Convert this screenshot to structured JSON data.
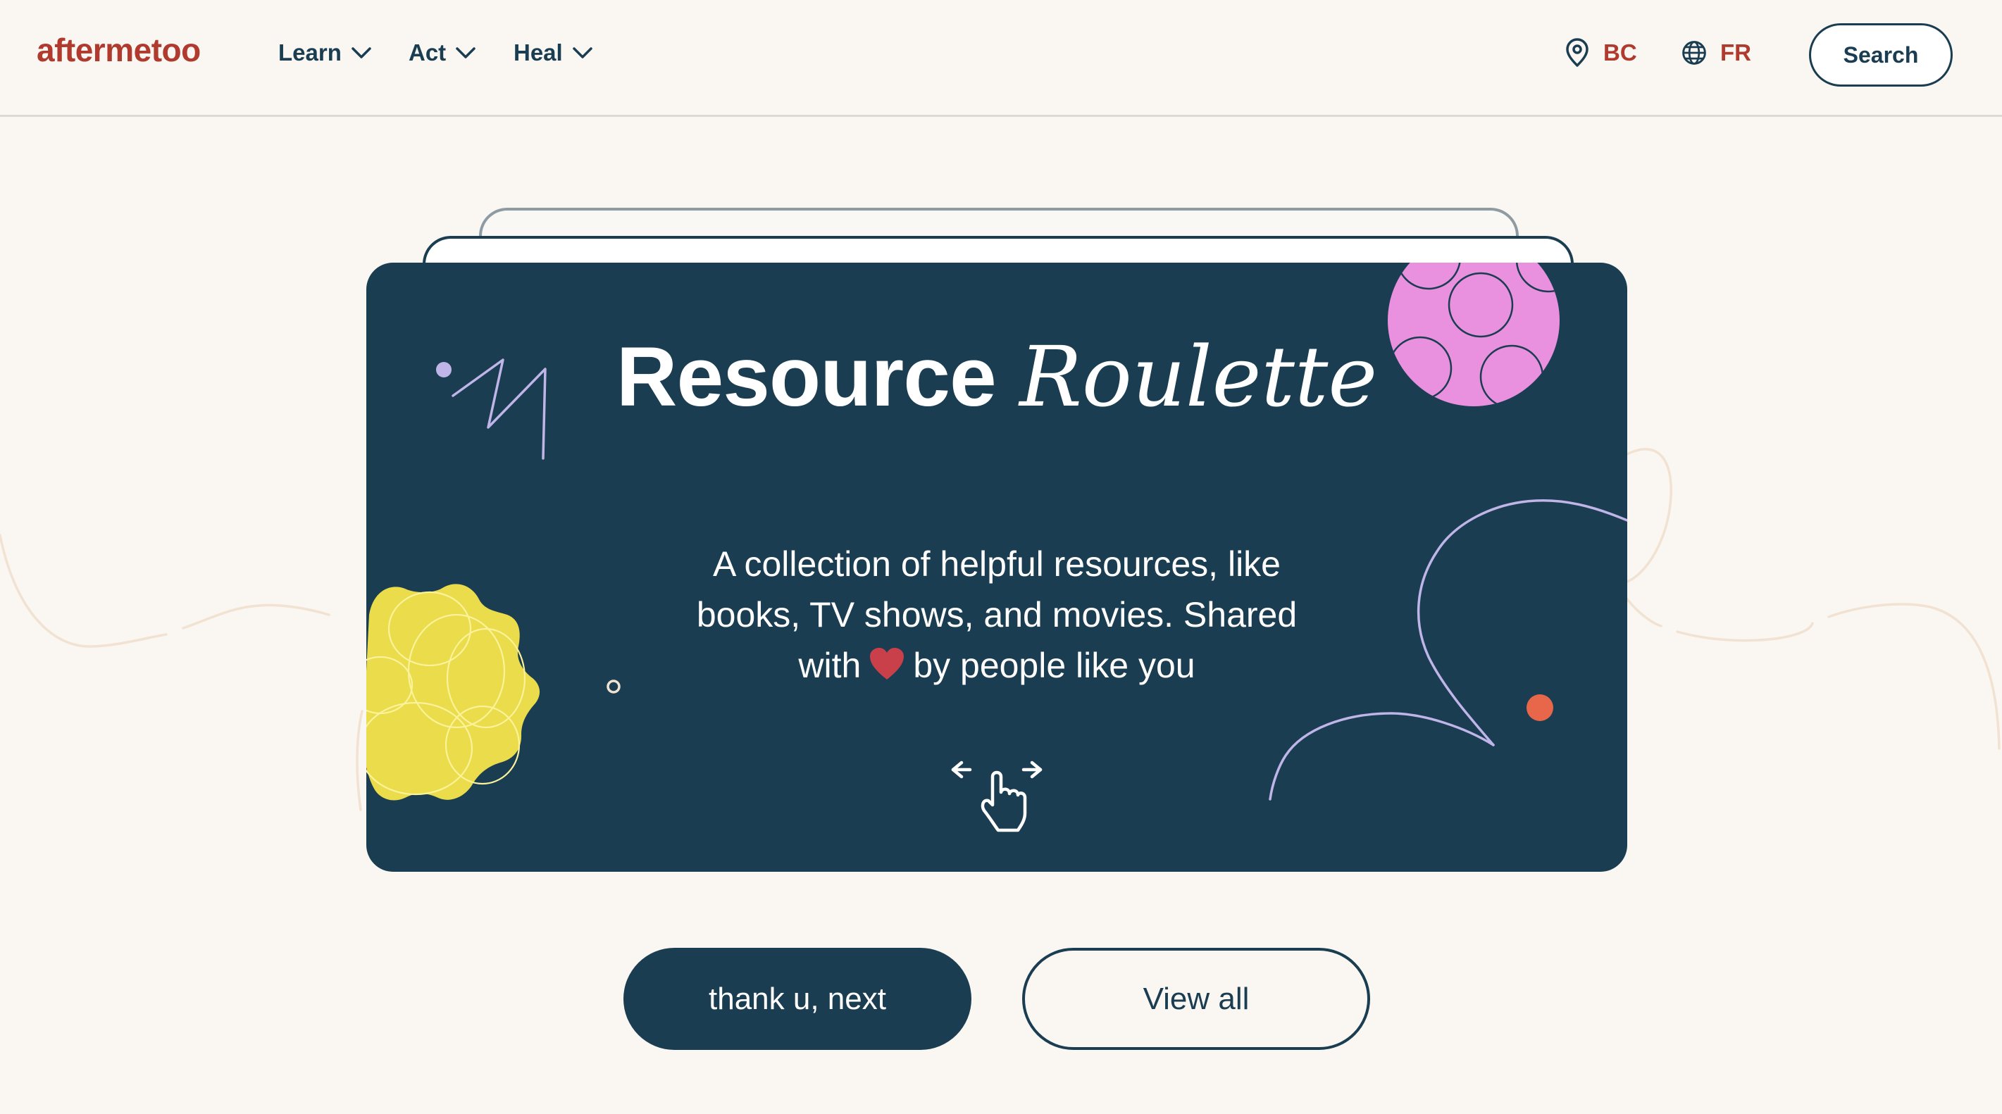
{
  "header": {
    "logo": "aftermetoo",
    "nav": [
      {
        "label": "Learn",
        "icon": "chevron-down-icon"
      },
      {
        "label": "Act",
        "icon": "chevron-down-icon"
      },
      {
        "label": "Heal",
        "icon": "chevron-down-icon"
      }
    ],
    "region": {
      "label": "BC",
      "icon": "map-pin-icon"
    },
    "language": {
      "label": "FR",
      "icon": "globe-icon"
    },
    "search_label": "Search"
  },
  "card": {
    "title_part1": "Resource",
    "title_part2": "Roulette",
    "description_before_heart": "A collection of helpful resources, like books, TV shows, and movies. Shared with",
    "description_after_heart": "by people like you",
    "heart_icon": "heart-icon",
    "swipe_hint_icon": "swipe-hand-icon"
  },
  "actions": {
    "next_label": "thank u, next",
    "view_all_label": "View all"
  },
  "colors": {
    "brand_red": "#B03A2E",
    "navy": "#1A3D51",
    "background": "#FAF7F3",
    "yellow_blob": "#EADC4B",
    "pink_circle": "#E990DF",
    "lavender_lines": "#BFB5E8",
    "orange_dot": "#E8674A",
    "heart": "#C9404A"
  }
}
